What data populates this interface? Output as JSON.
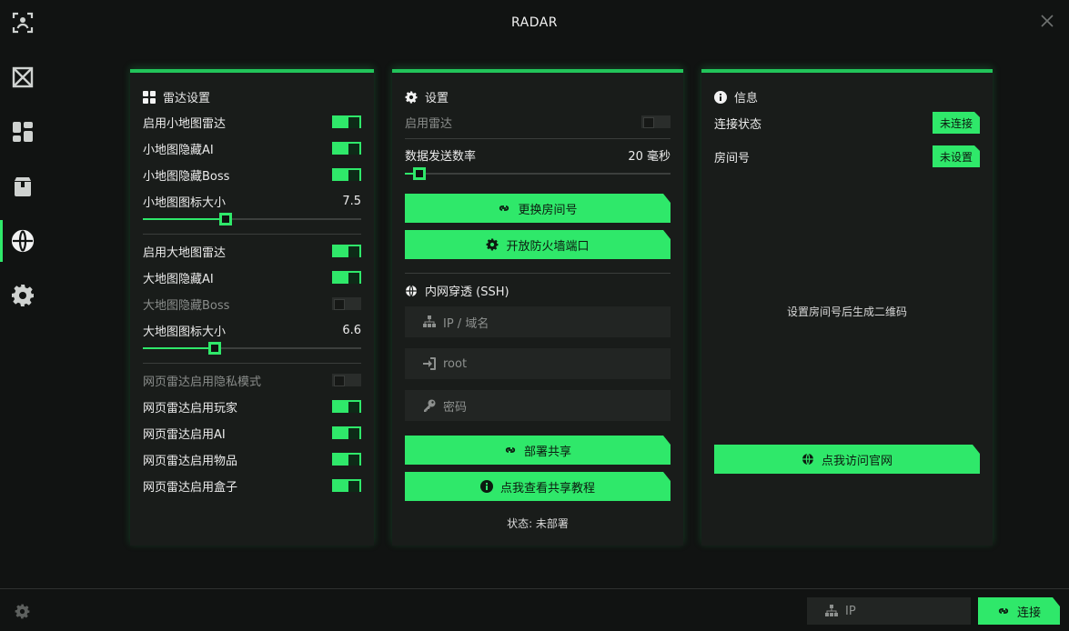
{
  "app": {
    "title": "RADAR"
  },
  "sidebar": {
    "items": [
      {
        "icon": "face-scan-icon"
      },
      {
        "icon": "crossed-box-icon"
      },
      {
        "icon": "dashboard-icon"
      },
      {
        "icon": "package-icon"
      },
      {
        "icon": "globe-icon",
        "active": true
      },
      {
        "icon": "gear-icon"
      }
    ]
  },
  "radar_panel": {
    "title": "雷达设置",
    "mini_radar": {
      "label": "启用小地图雷达",
      "on": true
    },
    "mini_hide_ai": {
      "label": "小地图隐藏AI",
      "on": true
    },
    "mini_hide_boss": {
      "label": "小地图隐藏Boss",
      "on": true
    },
    "mini_icon_size": {
      "label": "小地图图标大小",
      "value": "7.5",
      "fraction": 0.35
    },
    "big_radar": {
      "label": "启用大地图雷达",
      "on": true
    },
    "big_hide_ai": {
      "label": "大地图隐藏AI",
      "on": true
    },
    "big_hide_boss": {
      "label": "大地图隐藏Boss",
      "on": false
    },
    "big_icon_size": {
      "label": "大地图图标大小",
      "value": "6.6",
      "fraction": 0.3
    },
    "web_privacy": {
      "label": "网页雷达启用隐私模式",
      "on": false
    },
    "web_players": {
      "label": "网页雷达启用玩家",
      "on": true
    },
    "web_ai": {
      "label": "网页雷达启用AI",
      "on": true
    },
    "web_items": {
      "label": "网页雷达启用物品",
      "on": true
    },
    "web_boxes": {
      "label": "网页雷达启用盒子",
      "on": true
    }
  },
  "settings_panel": {
    "title": "设置",
    "enable_radar": {
      "label": "启用雷达",
      "on": false
    },
    "send_rate": {
      "label": "数据发送数率",
      "value": "20 毫秒",
      "fraction": 0.03
    },
    "change_room_button": "更换房间号",
    "open_firewall_button": "开放防火墙端口",
    "ssh": {
      "title": "内网穿透 (SSH)",
      "ip_placeholder": "IP / 域名",
      "user_value": "root",
      "password_placeholder": "密码"
    },
    "deploy_button": "部署共享",
    "tutorial_button": "点我查看共享教程",
    "status": "状态: 未部署"
  },
  "info_panel": {
    "title": "信息",
    "connection": {
      "label": "连接状态",
      "badge": "未连接"
    },
    "room": {
      "label": "房间号",
      "badge": "未设置"
    },
    "qr_note": "设置房间号后生成二维码",
    "website_button": "点我访问官网"
  },
  "footer": {
    "ip_placeholder": "IP",
    "connect_button": "连接"
  },
  "colors": {
    "accent": "#2fe86a",
    "panel": "#191c1a",
    "background": "#111312"
  }
}
